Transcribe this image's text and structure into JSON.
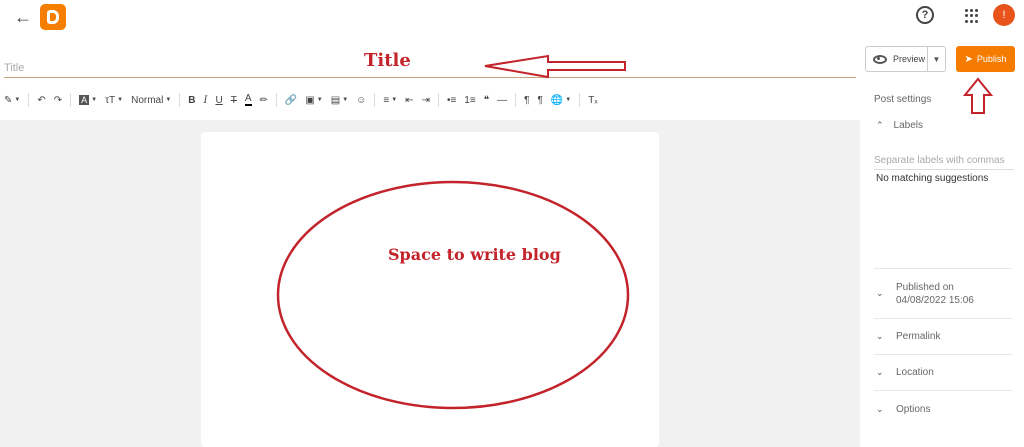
{
  "header": {
    "back_icon": "arrow-left-icon",
    "logo_icon": "blogger-logo-icon",
    "help_icon": "help-circle-icon",
    "apps_icon": "apps-grid-icon",
    "avatar_letter": "!"
  },
  "editor": {
    "title_placeholder": "Title",
    "preview_label": "Preview",
    "publish_label": "Publish",
    "font_size_label": "Normal"
  },
  "annotations": {
    "title_note": "Title",
    "body_note": "Space to write blog",
    "color": "#c3232b"
  },
  "sidebar": {
    "heading": "Post settings",
    "labels_title": "Labels",
    "labels_placeholder": "Separate labels with commas",
    "labels_suggestion": "No matching suggestions",
    "published_line1": "Published on",
    "published_line2": "04/08/2022 15:06",
    "permalink": "Permalink",
    "location": "Location",
    "options": "Options"
  },
  "colors": {
    "accent": "#f57c00",
    "avatar": "#e8531c"
  }
}
